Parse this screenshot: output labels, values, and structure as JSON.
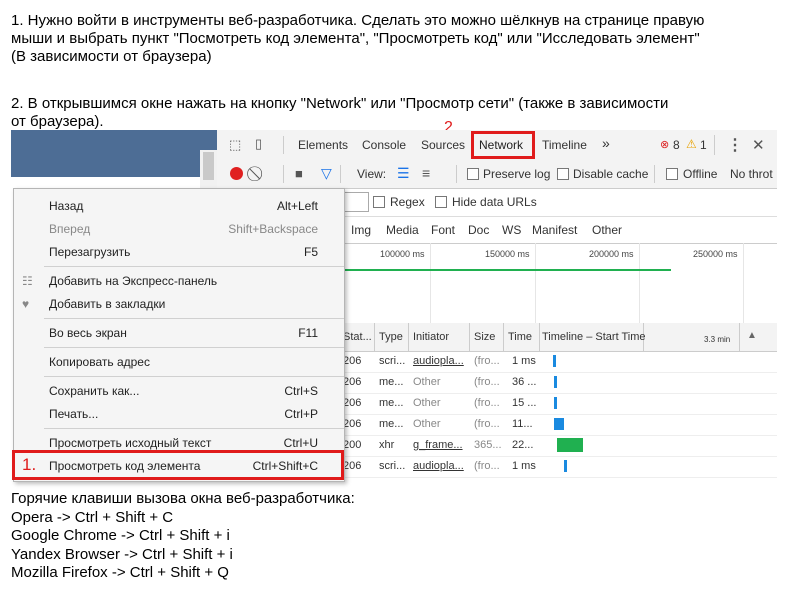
{
  "instructions": {
    "line1": "1. Нужно войти в инструменты веб-разработчика. Сделать это можно шёлкнув на странице правую",
    "line2": "мыши и выбрать пункт \"Посмотреть код элемента\", \"Просмотреть код\" или \"Исследовать элемент\"",
    "line3": "(В зависимости от браузера)",
    "line4": "2. В открывшимся окне нажать на кнопку \"Network\" или \"Просмотр сети\" (также в зависимости",
    "line5": "от браузера)."
  },
  "markers": {
    "one": "1.",
    "two": "2."
  },
  "devtools": {
    "tabs": [
      "Elements",
      "Console",
      "Sources",
      "Network",
      "Timeline"
    ],
    "more": "»",
    "errors": "8",
    "warnings": "1",
    "view_label": "View:",
    "preserve_log": "Preserve log",
    "disable_cache": "Disable cache",
    "offline": "Offline",
    "throttle": "No throt",
    "regex": "Regex",
    "hide_data_urls": "Hide data URLs",
    "types": [
      "Img",
      "Media",
      "Font",
      "Doc",
      "WS",
      "Manifest",
      "Other"
    ],
    "ticks": [
      "100000 ms",
      "150000 ms",
      "200000 ms",
      "250000 ms"
    ],
    "columns": [
      "Stat...",
      "Type",
      "Initiator",
      "Size",
      "Time",
      "Timeline – Start Time",
      "3.3 min"
    ],
    "rows": [
      {
        "status": "206",
        "type": "scri...",
        "initiator": "audiopla...",
        "size": "(fro...",
        "time": "1 ms"
      },
      {
        "status": "206",
        "type": "me...",
        "initiator": "Other",
        "size": "(fro...",
        "time": "36 ..."
      },
      {
        "status": "206",
        "type": "me...",
        "initiator": "Other",
        "size": "(fro...",
        "time": "15 ..."
      },
      {
        "status": "206",
        "type": "me...",
        "initiator": "Other",
        "size": "(fro...",
        "time": "11..."
      },
      {
        "status": "200",
        "type": "xhr",
        "initiator": "g_frame...",
        "size": "365...",
        "time": "22..."
      },
      {
        "status": "206",
        "type": "scri...",
        "initiator": "audiopla...",
        "size": "(fro...",
        "time": "1 ms"
      }
    ]
  },
  "context_menu": {
    "items": [
      {
        "label": "Назад",
        "shortcut": "Alt+Left"
      },
      {
        "label": "Вперед",
        "shortcut": "Shift+Backspace"
      },
      {
        "label": "Перезагрузить",
        "shortcut": "F5"
      },
      {
        "label": "Добавить на Экспресс-панель",
        "shortcut": ""
      },
      {
        "label": "Добавить в закладки",
        "shortcut": ""
      },
      {
        "label": "Во весь экран",
        "shortcut": "F11"
      },
      {
        "label": "Копировать адрес",
        "shortcut": ""
      },
      {
        "label": "Сохранить как...",
        "shortcut": "Ctrl+S"
      },
      {
        "label": "Печать...",
        "shortcut": "Ctrl+P"
      },
      {
        "label": "Просмотреть исходный текст",
        "shortcut": "Ctrl+U"
      },
      {
        "label": "Просмотреть код элемента",
        "shortcut": "Ctrl+Shift+C"
      }
    ]
  },
  "hotkeys": {
    "title": "Горячие клавиши вызова окна веб-разработчика:",
    "lines": [
      "Opera -> Ctrl + Shift + C",
      "Google Chrome -> Ctrl + Shift + i",
      "Yandex Browser -> Ctrl + Shift + i",
      "Mozilla Firefox -> Ctrl + Shift + Q"
    ]
  },
  "colors": {
    "annotation_red": "#e01b1b",
    "page_header": "#4d6d95",
    "waterfall_blue": "#1a8ae0",
    "waterfall_green": "#20b050"
  }
}
